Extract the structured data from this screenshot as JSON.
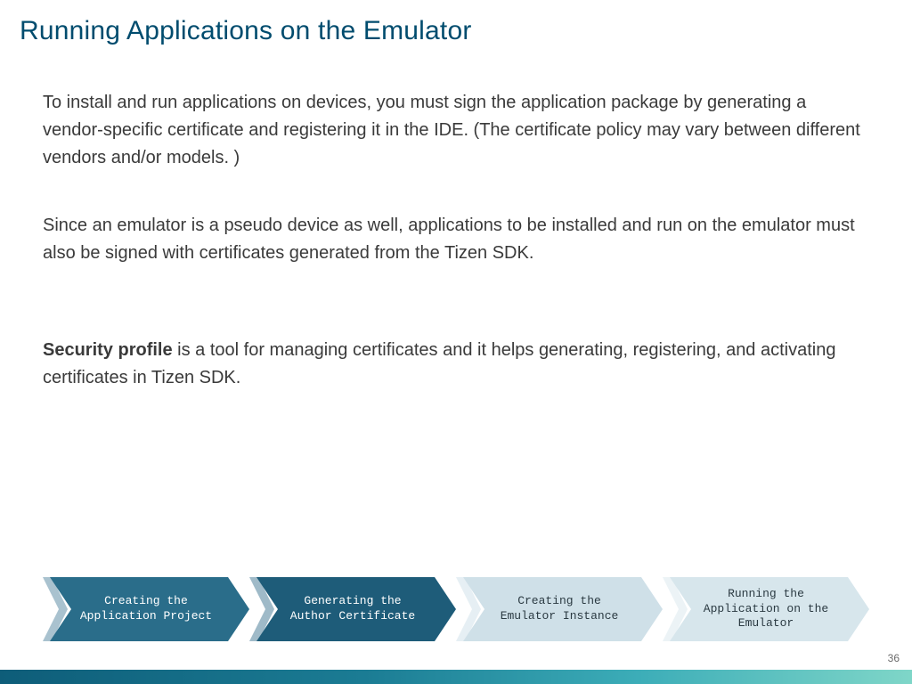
{
  "title": "Running Applications on the Emulator",
  "paragraphs": {
    "p1": "To install and run applications on devices, you must sign the application package by generating a vendor-specific certificate and registering it in the IDE. (The certificate policy may vary between different vendors and/or models. )",
    "p2": "Since an emulator is a pseudo device as well, applications to be installed and run on the emulator must also be signed with certificates generated from the Tizen SDK.",
    "p3_bold": "Security profile",
    "p3_rest": " is a tool for managing certificates and it helps generating, registering, and activating certificates in Tizen SDK."
  },
  "process": [
    {
      "line1": "Creating the",
      "line2": "Application Project",
      "fill": "#2a6d8a",
      "head": "#a9c2cf",
      "text_dark": false
    },
    {
      "line1": "Generating the",
      "line2": "Author Certificate",
      "fill": "#1e5c79",
      "head": "#9fbac8",
      "text_dark": false
    },
    {
      "line1": "Creating the",
      "line2": "Emulator Instance",
      "fill": "#cfe0e8",
      "head": "#e6eff4",
      "text_dark": true
    },
    {
      "line1": "Running the",
      "line2": "Application on the",
      "line3": "Emulator",
      "fill": "#d7e6ec",
      "head": "#ecf3f6",
      "text_dark": true
    }
  ],
  "page_number": "36"
}
